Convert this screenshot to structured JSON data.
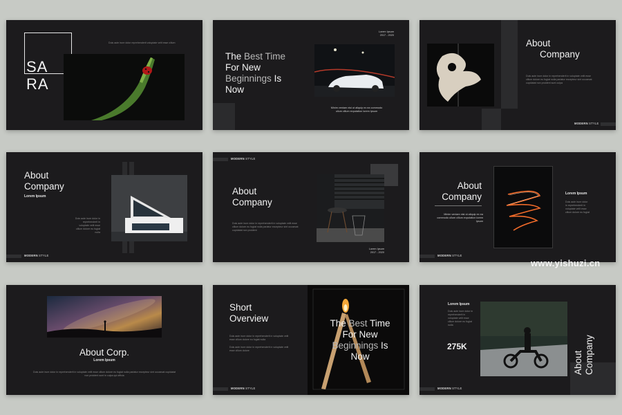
{
  "slides": {
    "s1": {
      "logo_line1": "SA",
      "logo_line2": "RA",
      "caption": "Duis aute irure dolor reprehenderit voluptate velit esse cillum"
    },
    "s2": {
      "title_a": "The ",
      "title_b": "Best Time",
      "title_c": "For New",
      "title_d": "Beginnings",
      "title_e": " Is",
      "title_f": "Now",
      "badge_l1": "Lorem Ipsum",
      "badge_l2": "2017 - 2020",
      "caption_l1": "Minim veniam nisi ut aliquip ex ea commodo",
      "caption_l2": "ullum cillum exputation lorem Ipsum"
    },
    "s3": {
      "title_l1": "About",
      "title_l2": "Company",
      "body": "Duis aute irure dolor in reprehenderit in voluptate velit esse cillum dolore eu fugiat nulla pariatur excepteur sint occaecat cupidatat non proident sunt culpa",
      "footer_a": "MODERN",
      "footer_b": " STYLE"
    },
    "s4": {
      "title_l1": "About",
      "title_l2": "Company",
      "subtitle": "Lorem Ipsum",
      "body": "Duis aute irure dolor in reprehenderit in voluptate velit esse cillum dolore eu fugiat nulla",
      "footer_a": "MODERN",
      "footer_b": " STYLE"
    },
    "s5": {
      "header_a": "MODERN",
      "header_b": " STYLE",
      "title_l1": "About",
      "title_l2": "Company",
      "body": "Duis aute irure dolor in reprehenderit in voluptate velit esse cillum dolore eu fugiat nulla pariatur excepteur sint occaecat cupidatat non proident",
      "badge_l1": "Lorem Ipsum",
      "badge_l2": "2017 - 2020"
    },
    "s6": {
      "title_l1": "About",
      "title_l2": "Company",
      "caption": "Minim veniam nisi ut aliquip ex ea commodo ullum cillum exputation lorem Ipsum",
      "side_title": "Lorem Ipsum",
      "side_body": "Duis aute irure dolor in reprehenderit in voluptate velit esse cillum dolore eu fugiat",
      "footer_a": "MODERN",
      "footer_b": " STYLE"
    },
    "s7": {
      "title": "About Corp.",
      "subtitle": "Lorem Ipsum",
      "body": "Duis aute irure dolor in reprehenderit in voluptate velit esse cillum dolore eu fugiat nulla pariatur excepteur sint occaecat cupidatat non proident sunt in culpa qui officia"
    },
    "s8": {
      "title_l1": "Short",
      "title_l2": "Overview",
      "body1": "Duis aute irure dolor in reprehenderit in voluptate velit esse cillum dolore eu fugiat nulla",
      "body2": "Duis aute irure dolor in reprehenderit in voluptate velit esse cillum dolore",
      "overlay_a": "The ",
      "overlay_b": "Best",
      "overlay_c": " Time",
      "overlay_d": "For New",
      "overlay_e": "Beginnings",
      "overlay_f": " Is",
      "overlay_g": "Now",
      "footer_a": "MODERN",
      "footer_b": " STYLE"
    },
    "s9": {
      "side_title": "Lorem Ipsum",
      "side_body": "Duis aute irure dolor in reprehenderit in voluptate velit esse cillum dolore eu fugiat nulla",
      "stat": "275K",
      "vertical_l1": "About",
      "vertical_l2": "Company",
      "footer_a": "MODERN",
      "footer_b": " STYLE"
    }
  },
  "watermark": "www.yishuzi.cn",
  "colors": {
    "background": "#c7cac5",
    "slide": "#1c1b1d",
    "accent_gray": "#b8b8b8"
  }
}
